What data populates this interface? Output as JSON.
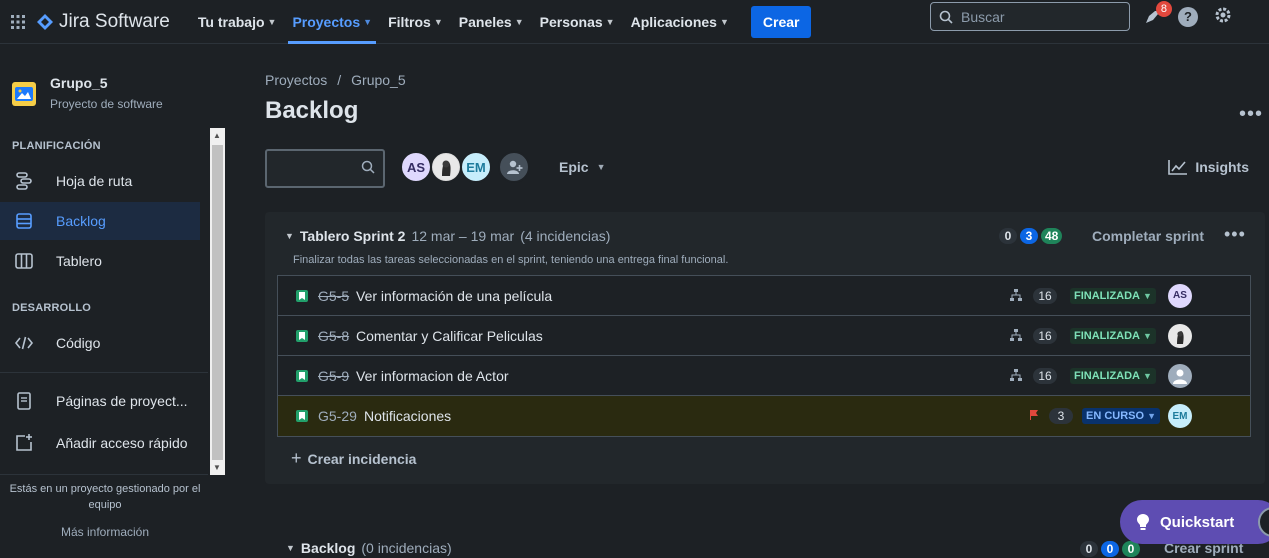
{
  "topbar": {
    "app_name": "Jira Software",
    "nav": [
      {
        "label": "Tu trabajo",
        "active": false
      },
      {
        "label": "Proyectos",
        "active": true
      },
      {
        "label": "Filtros",
        "active": false
      },
      {
        "label": "Paneles",
        "active": false
      },
      {
        "label": "Personas",
        "active": false
      },
      {
        "label": "Aplicaciones",
        "active": false
      }
    ],
    "create_label": "Crear",
    "search_placeholder": "Buscar",
    "notifications_count": "8",
    "help_label": "?"
  },
  "sidebar": {
    "project_name": "Grupo_5",
    "project_type": "Proyecto de software",
    "planning_title": "PLANIFICACIÓN",
    "planning_items": [
      {
        "label": "Hoja de ruta",
        "icon": "roadmap-icon"
      },
      {
        "label": "Backlog",
        "icon": "backlog-icon",
        "active": true
      },
      {
        "label": "Tablero",
        "icon": "board-icon"
      }
    ],
    "dev_title": "DESARROLLO",
    "dev_items": [
      {
        "label": "Código",
        "icon": "code-icon"
      }
    ],
    "extra_items": [
      {
        "label": "Páginas de proyect...",
        "icon": "pages-icon"
      },
      {
        "label": "Añadir acceso rápido",
        "icon": "add-shortcut-icon"
      }
    ],
    "footer_text": "Estás en un proyecto gestionado por el equipo",
    "footer_link": "Más información"
  },
  "main": {
    "breadcrumb": [
      "Proyectos",
      "/",
      "Grupo_5"
    ],
    "title": "Backlog",
    "avatars": [
      "AS",
      "",
      "EM"
    ],
    "epic_label": "Epic",
    "insights_label": "Insights"
  },
  "sprint": {
    "name": "Tablero Sprint 2",
    "dates": "12 mar – 19 mar",
    "issue_count": "(4 incidencias)",
    "goal": "Finalizar todas las tareas seleccionadas en el sprint, teniendo una entrega final funcional.",
    "counts": {
      "todo": "0",
      "in_progress": "3",
      "done": "48"
    },
    "complete_label": "Completar sprint",
    "create_issue_label": "Crear incidencia",
    "issues": [
      {
        "key": "G5-5",
        "summary": "Ver información de una película",
        "points": "16",
        "status": "FINALIZADA",
        "assignee": "AS",
        "done": true
      },
      {
        "key": "G5-8",
        "summary": "Comentar y Calificar Peliculas",
        "points": "16",
        "status": "FINALIZADA",
        "assignee": "",
        "done": true
      },
      {
        "key": "G5-9",
        "summary": "Ver informacion de Actor",
        "points": "16",
        "status": "FINALIZADA",
        "assignee": "",
        "done": true
      },
      {
        "key": "G5-29",
        "summary": "Notificaciones",
        "points": "3",
        "status": "EN CURSO",
        "assignee": "EM",
        "done": false
      }
    ]
  },
  "backlog": {
    "name": "Backlog",
    "issue_count": "(0 incidencias)",
    "counts": {
      "todo": "0",
      "in_progress": "0",
      "done": "0"
    },
    "create_sprint_label": "Crear sprint"
  },
  "quickstart_label": "Quickstart",
  "colors": {
    "accent": "#579dff",
    "create": "#0c66e4",
    "done": "#1f845a",
    "quickstart": "#5e4db2"
  }
}
